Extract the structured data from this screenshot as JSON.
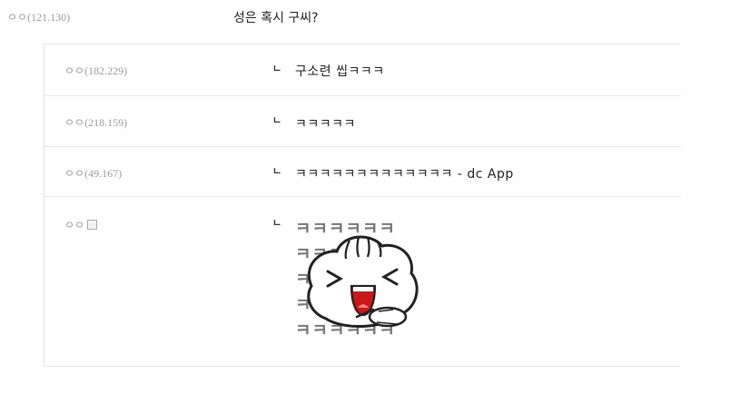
{
  "top_comment": {
    "author": "ㅇㅇ(121.130)",
    "text": "성은 혹시 구씨?"
  },
  "replies": [
    {
      "author": "ㅇㅇ(182.229)",
      "arrow": "ㄴ",
      "text": "구소련 씹ㅋㅋㅋ"
    },
    {
      "author": "ㅇㅇ(218.159)",
      "arrow": "ㄴ",
      "text": "ㅋㅋㅋㅋㅋ"
    },
    {
      "author": "ㅇㅇ(49.167)",
      "arrow": "ㄴ",
      "text": "ㅋㅋㅋㅋㅋㅋㅋㅋㅋㅋㅋㅋㅋ - dc App"
    },
    {
      "author": "ㅇㅇ",
      "arrow": "ㄴ",
      "sticker_text": "ㅋㅋㅋㅋㅋㅋ",
      "sticker_icon": "laughing-dumpling-pointing-sticker"
    }
  ]
}
